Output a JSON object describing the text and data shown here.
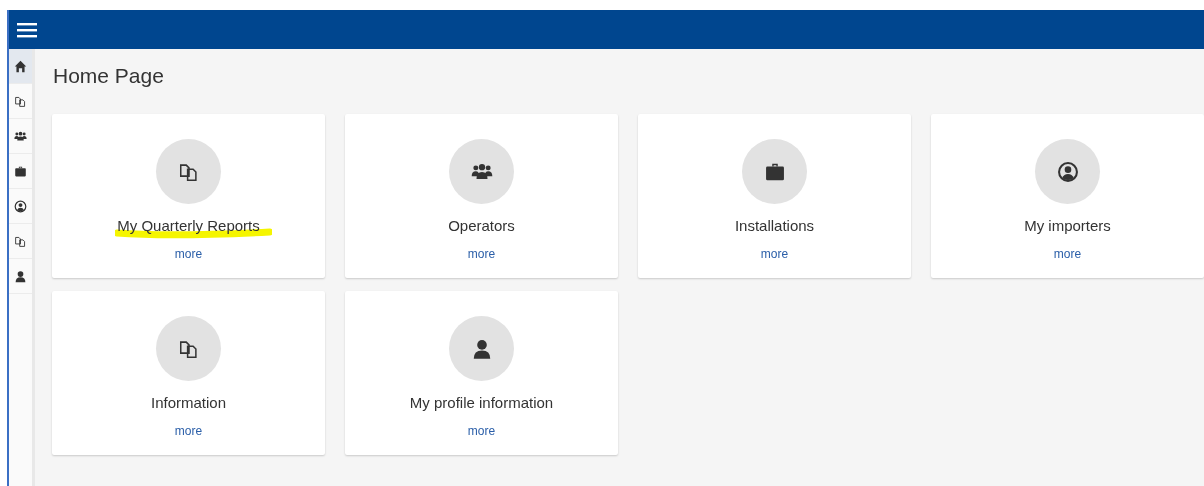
{
  "page": {
    "title": "Home Page"
  },
  "sidebar": {
    "items": [
      {
        "kind": "home",
        "selected": true
      },
      {
        "kind": "documents",
        "selected": false
      },
      {
        "kind": "group",
        "selected": false
      },
      {
        "kind": "briefcase",
        "selected": false
      },
      {
        "kind": "account",
        "selected": false
      },
      {
        "kind": "documents",
        "selected": false
      },
      {
        "kind": "user",
        "selected": false
      }
    ]
  },
  "cards": [
    {
      "kind": "documents",
      "title": "My Quarterly Reports",
      "link": "more",
      "highlighted": true
    },
    {
      "kind": "group",
      "title": "Operators",
      "link": "more",
      "highlighted": false
    },
    {
      "kind": "briefcase",
      "title": "Installations",
      "link": "more",
      "highlighted": false
    },
    {
      "kind": "account",
      "title": "My importers",
      "link": "more",
      "highlighted": false
    },
    {
      "kind": "documents",
      "title": "Information",
      "link": "more",
      "highlighted": false
    },
    {
      "kind": "user",
      "title": "My profile information",
      "link": "more",
      "highlighted": false
    }
  ]
}
